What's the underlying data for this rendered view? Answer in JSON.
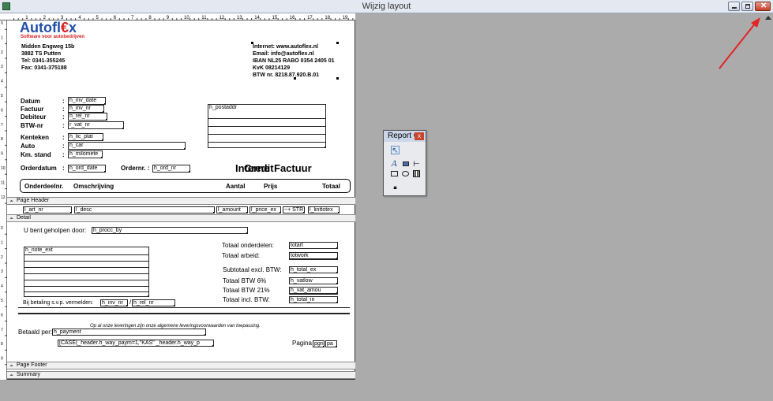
{
  "window": {
    "title": "Wijzig layout"
  },
  "ruler": {
    "h_numbers": [
      "1",
      "2",
      "3",
      "4",
      "5",
      "6",
      "7",
      "8",
      "9",
      "10",
      "11",
      "12",
      "13",
      "14",
      "15",
      "16",
      "17",
      "18",
      "19"
    ],
    "v_header": [
      "0",
      "1",
      "2",
      "3",
      "4",
      "5",
      "6",
      "7",
      "8",
      "9",
      "10",
      "11",
      "12"
    ],
    "v_detail": [
      "0",
      "1",
      "2",
      "3",
      "4",
      "5",
      "6",
      "7",
      "8",
      "9"
    ]
  },
  "company": {
    "logo_left": "Autofl",
    "logo_euro": "€",
    "logo_right": "x",
    "tagline": "Software voor autobedrijven",
    "address_lines": [
      "Midden Engweg 15b",
      "3882 TS  Putten",
      "Tel: 0341-355245",
      "Fax: 0341-375188"
    ],
    "contact_lines": [
      "Internet: www.autoflex.nl",
      "Email: info@autoflex.nl",
      "IBAN NL25 RABO 0354 2405 01",
      "KvK 08214129",
      "BTW nr. 8218.87.920.B.01"
    ]
  },
  "header_labels": [
    "Datum",
    "Factuur",
    "Debiteur",
    "BTW-nr",
    "Kenteken",
    "Auto",
    "Km. stand"
  ],
  "header_fields": [
    "h_inv_date",
    "h_inv_nr",
    "h_rel_nr",
    "r_vat_nr",
    "h_lic_plat",
    "h_car",
    "h_milomete"
  ],
  "postaddr_field": "h_postaddr",
  "orderdatum": {
    "label": "Orderdatum",
    "field": "h_ord_date",
    "ordernr_label": "Ordernr. :",
    "ordernr_field": "h_ord_nr"
  },
  "doc_titles": {
    "a": "Interne",
    "b": "Credit",
    "c": "Factuur"
  },
  "columns": {
    "col1": "Onderdeelnr.",
    "col2": "Omschrijving",
    "col3": "Aantal",
    "col4": "Prijs",
    "col5": "Totaal"
  },
  "bands": {
    "page_header": "Page Header",
    "detail": "Detail",
    "page_footer": "Page Footer",
    "summary": "Summary"
  },
  "detail_fields": [
    "l_art_nr",
    "l_desc",
    "l_amount",
    "l_price_ex",
    "~+ STR",
    "l_linttotex"
  ],
  "footer": {
    "helped_label": "U bent geholpen door:",
    "helped_field": "h_procc_by",
    "note_field": "h_note_ext",
    "payment_ref_label": "Bij betaling s.v.p. vermelden:",
    "payment_ref_field1": "h_inv_nr",
    "payment_ref_sep": "/",
    "payment_ref_field2": "h_rel_nr",
    "conditions": "Op al onze leveringen zijn onze algemene leveringsvoorwaarden van toepassing.",
    "paid_label": "Betaald per:",
    "paid_field": "h_payment",
    "case_field": "[CASE(_header.h_way_paym=1,\"KAS\" _header.h_way_p",
    "page_label": "Pagina",
    "page_field1": "pgn",
    "page_field2": "pa"
  },
  "totals": [
    {
      "label": "Totaal onderdelen:",
      "field": "totart"
    },
    {
      "label": "Totaal arbeid:",
      "field": "totwork"
    },
    {
      "label": "Subtotaal excl. BTW:",
      "field": "h_total_ex"
    },
    {
      "label": "Totaal BTW  6%",
      "field": "h_vatlow"
    },
    {
      "label": "Totaal BTW  21%",
      "field": "h_vat_amou"
    },
    {
      "label": "Totaal incl. BTW:",
      "field": "h_total_in"
    }
  ],
  "toolbox": {
    "title": "Report C",
    "close": "x"
  },
  "colors": {
    "logo_blue": "#1f4fa8",
    "logo_red": "#d42020",
    "titlebar": "#e3e8f1",
    "workspace": "#ababab",
    "annotation_arrow": "#e32424"
  }
}
